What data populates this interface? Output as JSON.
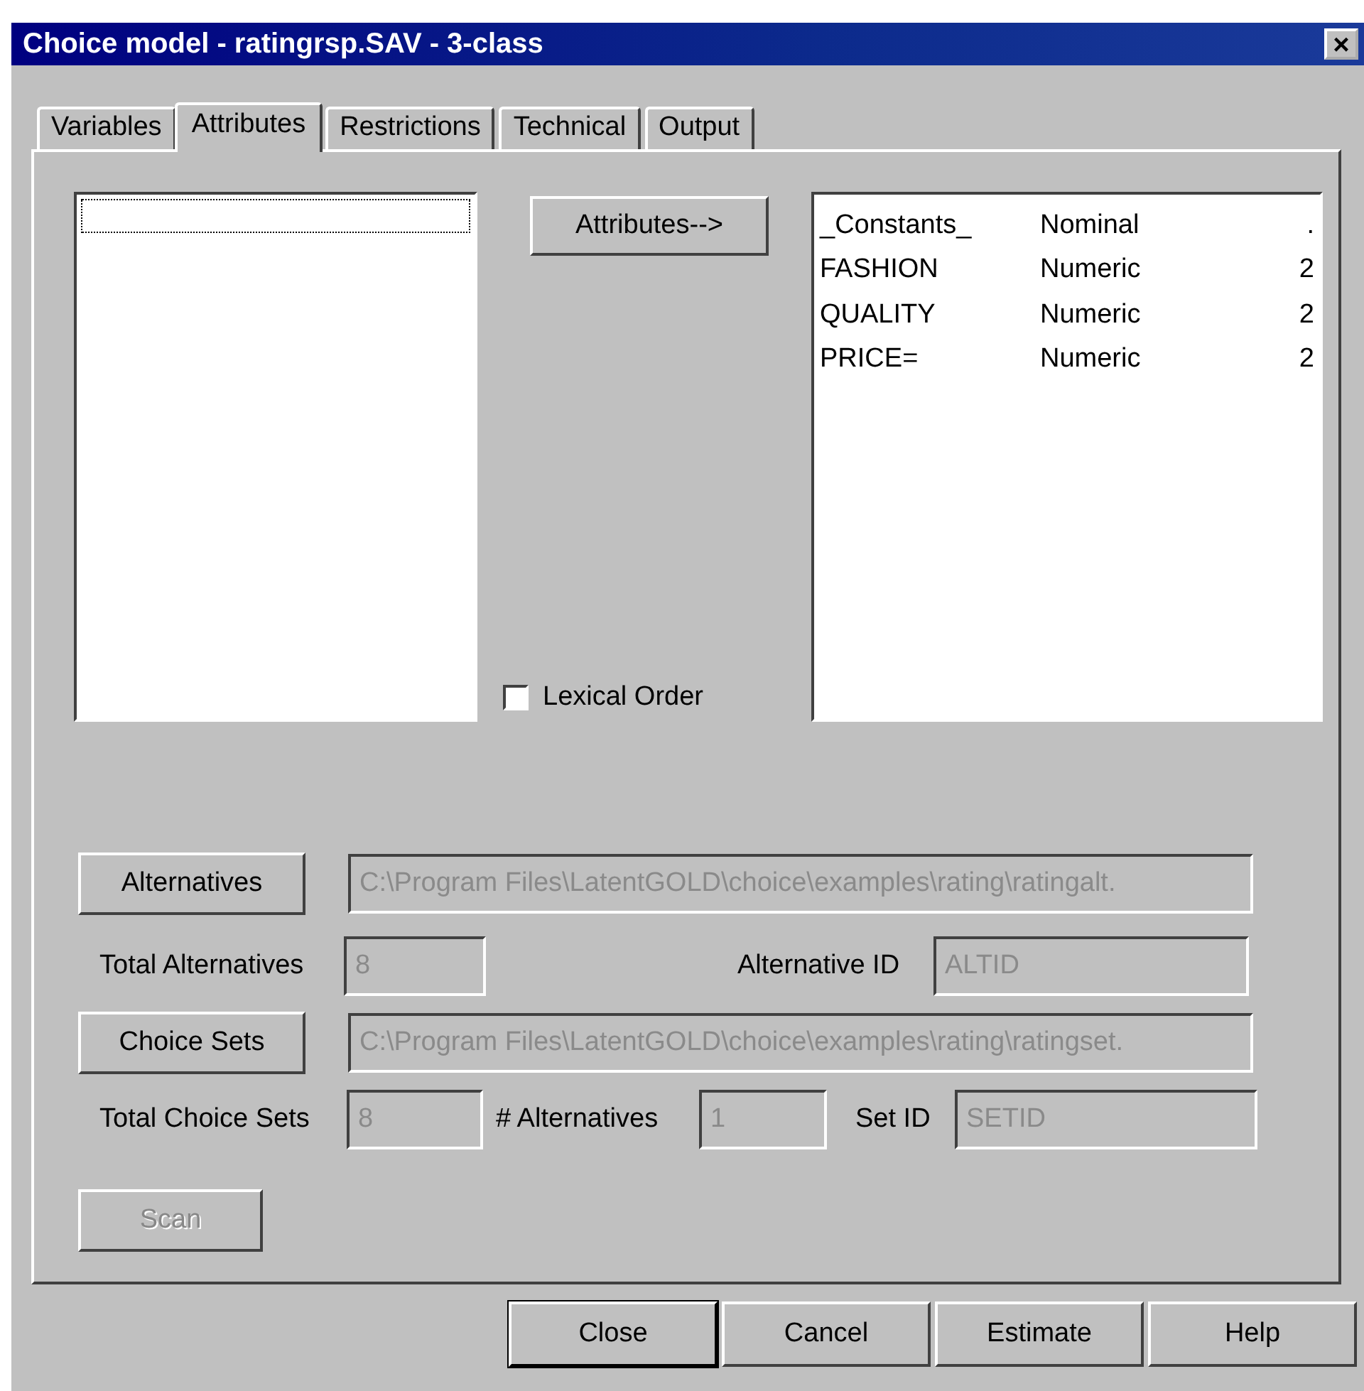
{
  "window": {
    "title": "Choice model - ratingrsp.SAV - 3-class",
    "close": "×"
  },
  "tabs": [
    {
      "label": "Variables",
      "selected": false
    },
    {
      "label": "Attributes",
      "selected": true
    },
    {
      "label": "Restrictions",
      "selected": false
    },
    {
      "label": "Technical",
      "selected": false
    },
    {
      "label": "Output",
      "selected": false
    }
  ],
  "attributes_button": "Attributes-->",
  "lexical_order": {
    "label": "Lexical Order",
    "checked": false
  },
  "attributes": [
    {
      "name": "_Constants_",
      "type": "Nominal",
      "count": "."
    },
    {
      "name": "FASHION",
      "type": "Numeric",
      "count": "2"
    },
    {
      "name": "QUALITY",
      "type": "Numeric",
      "count": "2"
    },
    {
      "name": "PRICE=",
      "type": "Numeric",
      "count": "2"
    }
  ],
  "alternatives": {
    "button": "Alternatives",
    "path": "C:\\Program Files\\LatentGOLD\\choice\\examples\\rating\\ratingalt.",
    "disabled": true
  },
  "total_alternatives": {
    "label": "Total Alternatives",
    "value": "8",
    "disabled": true
  },
  "alternative_id": {
    "label": "Alternative ID",
    "value": "ALTID",
    "disabled": true
  },
  "choice_sets": {
    "button": "Choice Sets",
    "path": "C:\\Program Files\\LatentGOLD\\choice\\examples\\rating\\ratingset.",
    "disabled": true
  },
  "total_choice_sets": {
    "label": "Total Choice Sets",
    "value": "8",
    "disabled": true
  },
  "n_alternatives": {
    "label": "# Alternatives",
    "value": "1",
    "disabled": true
  },
  "set_id": {
    "label": "Set ID",
    "value": "SETID",
    "disabled": true
  },
  "scan": {
    "label": "Scan",
    "disabled": true
  },
  "buttons": [
    {
      "label": "Close",
      "default": true
    },
    {
      "label": "Cancel",
      "default": false
    },
    {
      "label": "Estimate",
      "default": false
    },
    {
      "label": "Help",
      "default": false
    }
  ]
}
